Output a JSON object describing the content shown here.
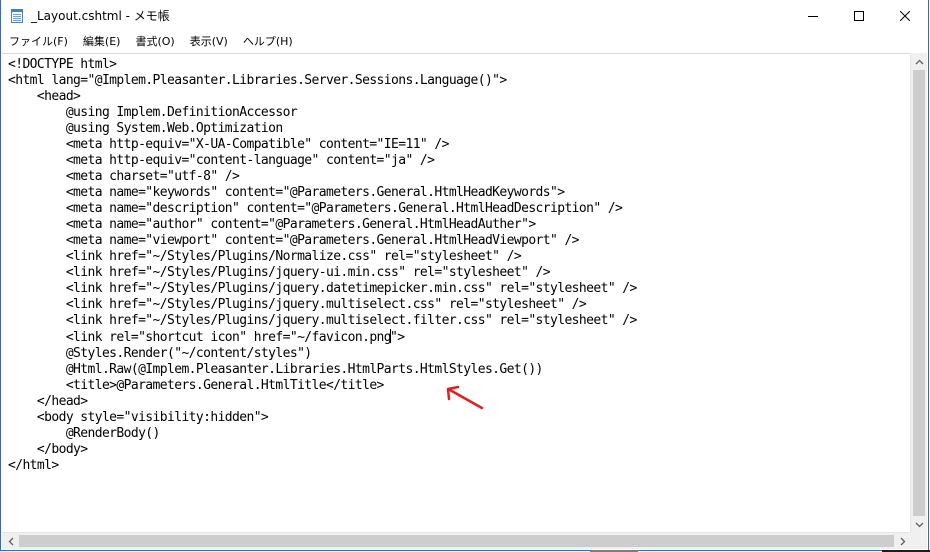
{
  "window": {
    "title": "_Layout.cshtml - メモ帳",
    "icon": "notepad-icon",
    "controls": [
      "minimize-icon",
      "maximize-icon",
      "close-icon"
    ]
  },
  "menu": {
    "items": [
      "ファイル(F)",
      "編集(E)",
      "書式(O)",
      "表示(V)",
      "ヘルプ(H)"
    ]
  },
  "editor": {
    "lines": [
      "<!DOCTYPE html>",
      "<html lang=\"@Implem.Pleasanter.Libraries.Server.Sessions.Language()\">",
      "    <head>",
      "        @using Implem.DefinitionAccessor",
      "        @using System.Web.Optimization",
      "        <meta http-equiv=\"X-UA-Compatible\" content=\"IE=11\" />",
      "        <meta http-equiv=\"content-language\" content=\"ja\" />",
      "        <meta charset=\"utf-8\" />",
      "        <meta name=\"keywords\" content=\"@Parameters.General.HtmlHeadKeywords\">",
      "        <meta name=\"description\" content=\"@Parameters.General.HtmlHeadDescription\" />",
      "        <meta name=\"author\" content=\"@Parameters.General.HtmlHeadAuther\">",
      "        <meta name=\"viewport\" content=\"@Parameters.General.HtmlHeadViewport\" />",
      "        <link href=\"~/Styles/Plugins/Normalize.css\" rel=\"stylesheet\" />",
      "        <link href=\"~/Styles/Plugins/jquery-ui.min.css\" rel=\"stylesheet\" />",
      "        <link href=\"~/Styles/Plugins/jquery.datetimepicker.min.css\" rel=\"stylesheet\" />",
      "        <link href=\"~/Styles/Plugins/jquery.multiselect.css\" rel=\"stylesheet\" />",
      "        <link href=\"~/Styles/Plugins/jquery.multiselect.filter.css\" rel=\"stylesheet\" />",
      "        <link rel=\"shortcut icon\" href=\"~/favicon.png\">",
      "        @Styles.Render(\"~/content/styles\")",
      "        @Html.Raw(@Implem.Pleasanter.Libraries.HtmlParts.HtmlStyles.Get())",
      "        <title>@Parameters.General.HtmlTitle</title>",
      "    </head>",
      "    <body style=\"visibility:hidden\">",
      "        @RenderBody()",
      "    </body>",
      "</html>"
    ],
    "caret_line_index": 17,
    "annotation_arrow": {
      "color": "#e02020",
      "icon": "red-arrow-icon"
    }
  },
  "colors": {
    "window_border": "#2b6cc4",
    "scrollbar_track": "#f0f0f0",
    "scrollbar_thumb": "#cdcdcd",
    "annotation": "#e02020"
  }
}
